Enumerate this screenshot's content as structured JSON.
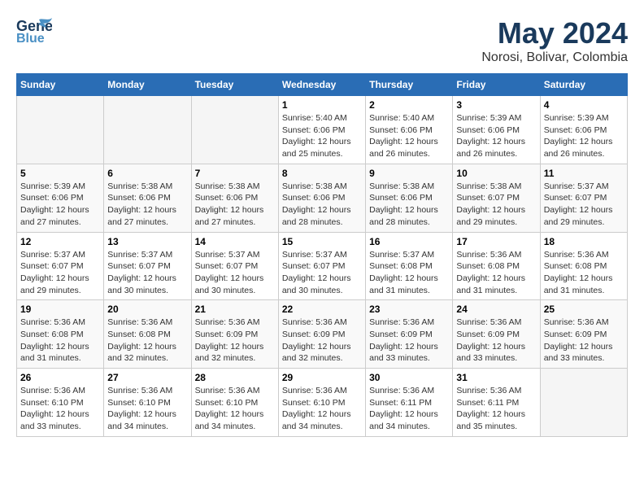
{
  "header": {
    "logo_line1": "General",
    "logo_line2": "Blue",
    "month": "May 2024",
    "location": "Norosi, Bolivar, Colombia"
  },
  "weekdays": [
    "Sunday",
    "Monday",
    "Tuesday",
    "Wednesday",
    "Thursday",
    "Friday",
    "Saturday"
  ],
  "weeks": [
    [
      {
        "day": "",
        "info": ""
      },
      {
        "day": "",
        "info": ""
      },
      {
        "day": "",
        "info": ""
      },
      {
        "day": "1",
        "info": "Sunrise: 5:40 AM\nSunset: 6:06 PM\nDaylight: 12 hours\nand 25 minutes."
      },
      {
        "day": "2",
        "info": "Sunrise: 5:40 AM\nSunset: 6:06 PM\nDaylight: 12 hours\nand 26 minutes."
      },
      {
        "day": "3",
        "info": "Sunrise: 5:39 AM\nSunset: 6:06 PM\nDaylight: 12 hours\nand 26 minutes."
      },
      {
        "day": "4",
        "info": "Sunrise: 5:39 AM\nSunset: 6:06 PM\nDaylight: 12 hours\nand 26 minutes."
      }
    ],
    [
      {
        "day": "5",
        "info": "Sunrise: 5:39 AM\nSunset: 6:06 PM\nDaylight: 12 hours\nand 27 minutes."
      },
      {
        "day": "6",
        "info": "Sunrise: 5:38 AM\nSunset: 6:06 PM\nDaylight: 12 hours\nand 27 minutes."
      },
      {
        "day": "7",
        "info": "Sunrise: 5:38 AM\nSunset: 6:06 PM\nDaylight: 12 hours\nand 27 minutes."
      },
      {
        "day": "8",
        "info": "Sunrise: 5:38 AM\nSunset: 6:06 PM\nDaylight: 12 hours\nand 28 minutes."
      },
      {
        "day": "9",
        "info": "Sunrise: 5:38 AM\nSunset: 6:06 PM\nDaylight: 12 hours\nand 28 minutes."
      },
      {
        "day": "10",
        "info": "Sunrise: 5:38 AM\nSunset: 6:07 PM\nDaylight: 12 hours\nand 29 minutes."
      },
      {
        "day": "11",
        "info": "Sunrise: 5:37 AM\nSunset: 6:07 PM\nDaylight: 12 hours\nand 29 minutes."
      }
    ],
    [
      {
        "day": "12",
        "info": "Sunrise: 5:37 AM\nSunset: 6:07 PM\nDaylight: 12 hours\nand 29 minutes."
      },
      {
        "day": "13",
        "info": "Sunrise: 5:37 AM\nSunset: 6:07 PM\nDaylight: 12 hours\nand 30 minutes."
      },
      {
        "day": "14",
        "info": "Sunrise: 5:37 AM\nSunset: 6:07 PM\nDaylight: 12 hours\nand 30 minutes."
      },
      {
        "day": "15",
        "info": "Sunrise: 5:37 AM\nSunset: 6:07 PM\nDaylight: 12 hours\nand 30 minutes."
      },
      {
        "day": "16",
        "info": "Sunrise: 5:37 AM\nSunset: 6:08 PM\nDaylight: 12 hours\nand 31 minutes."
      },
      {
        "day": "17",
        "info": "Sunrise: 5:36 AM\nSunset: 6:08 PM\nDaylight: 12 hours\nand 31 minutes."
      },
      {
        "day": "18",
        "info": "Sunrise: 5:36 AM\nSunset: 6:08 PM\nDaylight: 12 hours\nand 31 minutes."
      }
    ],
    [
      {
        "day": "19",
        "info": "Sunrise: 5:36 AM\nSunset: 6:08 PM\nDaylight: 12 hours\nand 31 minutes."
      },
      {
        "day": "20",
        "info": "Sunrise: 5:36 AM\nSunset: 6:08 PM\nDaylight: 12 hours\nand 32 minutes."
      },
      {
        "day": "21",
        "info": "Sunrise: 5:36 AM\nSunset: 6:09 PM\nDaylight: 12 hours\nand 32 minutes."
      },
      {
        "day": "22",
        "info": "Sunrise: 5:36 AM\nSunset: 6:09 PM\nDaylight: 12 hours\nand 32 minutes."
      },
      {
        "day": "23",
        "info": "Sunrise: 5:36 AM\nSunset: 6:09 PM\nDaylight: 12 hours\nand 33 minutes."
      },
      {
        "day": "24",
        "info": "Sunrise: 5:36 AM\nSunset: 6:09 PM\nDaylight: 12 hours\nand 33 minutes."
      },
      {
        "day": "25",
        "info": "Sunrise: 5:36 AM\nSunset: 6:09 PM\nDaylight: 12 hours\nand 33 minutes."
      }
    ],
    [
      {
        "day": "26",
        "info": "Sunrise: 5:36 AM\nSunset: 6:10 PM\nDaylight: 12 hours\nand 33 minutes."
      },
      {
        "day": "27",
        "info": "Sunrise: 5:36 AM\nSunset: 6:10 PM\nDaylight: 12 hours\nand 34 minutes."
      },
      {
        "day": "28",
        "info": "Sunrise: 5:36 AM\nSunset: 6:10 PM\nDaylight: 12 hours\nand 34 minutes."
      },
      {
        "day": "29",
        "info": "Sunrise: 5:36 AM\nSunset: 6:10 PM\nDaylight: 12 hours\nand 34 minutes."
      },
      {
        "day": "30",
        "info": "Sunrise: 5:36 AM\nSunset: 6:11 PM\nDaylight: 12 hours\nand 34 minutes."
      },
      {
        "day": "31",
        "info": "Sunrise: 5:36 AM\nSunset: 6:11 PM\nDaylight: 12 hours\nand 35 minutes."
      },
      {
        "day": "",
        "info": ""
      }
    ]
  ]
}
